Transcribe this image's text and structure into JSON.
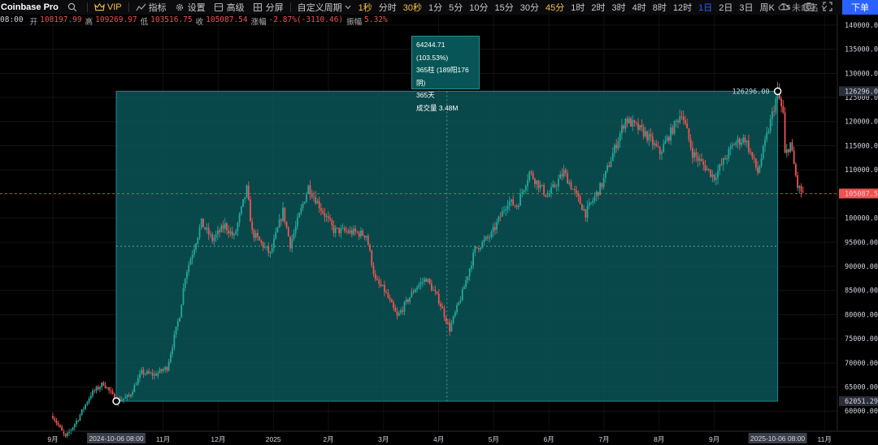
{
  "toolbar": {
    "symbol": "Coinbase Pro",
    "vip": "VIP",
    "indicators": "指标",
    "settings": "设置",
    "advanced": "高级",
    "split": "分屏",
    "custom_period": "自定义周期",
    "intervals": [
      {
        "label": "1秒",
        "state": "hl"
      },
      {
        "label": "分时",
        "state": ""
      },
      {
        "label": "30秒",
        "state": "hl"
      },
      {
        "label": "1分",
        "state": ""
      },
      {
        "label": "5分",
        "state": ""
      },
      {
        "label": "10分",
        "state": ""
      },
      {
        "label": "15分",
        "state": ""
      },
      {
        "label": "30分",
        "state": ""
      },
      {
        "label": "45分",
        "state": "hl"
      },
      {
        "label": "1时",
        "state": ""
      },
      {
        "label": "2时",
        "state": ""
      },
      {
        "label": "3时",
        "state": ""
      },
      {
        "label": "4时",
        "state": ""
      },
      {
        "label": "8时",
        "state": ""
      },
      {
        "label": "12时",
        "state": ""
      },
      {
        "label": "1日",
        "state": "active"
      },
      {
        "label": "2日",
        "state": ""
      },
      {
        "label": "3日",
        "state": ""
      },
      {
        "label": "周K",
        "state": ""
      },
      {
        "label": "1s",
        "state": ""
      }
    ],
    "unnamed": "未命名",
    "order": "下单"
  },
  "ohlc": {
    "time": "08:00",
    "open_label": "开",
    "open": "108197.99",
    "high_label": "高",
    "high": "109269.97",
    "low_label": "低",
    "low": "103516.75",
    "close_label": "收",
    "close": "105087.54",
    "change_label": "涨幅",
    "change": "-2.87%(-3110.46)",
    "amp_label": "振幅",
    "amp": "5.32%"
  },
  "tooltip": {
    "change": "64244.71 (103.53%)",
    "bars": "365柱 (189阳176阴)",
    "days": "365天",
    "volume": "成交量 3.48M"
  },
  "colors": {
    "up": "#26a69a",
    "down": "#ef5350",
    "range_fill": "#0b5557",
    "accent": "#2962ff"
  },
  "chart_data": {
    "type": "candlestick",
    "y_ticks": [
      "140000.00",
      "135000.00",
      "130000.00",
      "125000.00",
      "120000.00",
      "115000.00",
      "110000.00",
      "105000.00",
      "100000.00",
      "95000.00",
      "90000.00",
      "85000.00",
      "80000.00",
      "75000.00",
      "70000.00",
      "65000.00",
      "60000.00"
    ],
    "ylim": [
      56000,
      141500
    ],
    "x_ticks": [
      {
        "label": "9月",
        "m": 0
      },
      {
        "label": "11月",
        "m": 2
      },
      {
        "label": "12月",
        "m": 3
      },
      {
        "label": "2025",
        "m": 4
      },
      {
        "label": "2月",
        "m": 5
      },
      {
        "label": "3月",
        "m": 6
      },
      {
        "label": "4月",
        "m": 7
      },
      {
        "label": "5月",
        "m": 8
      },
      {
        "label": "6月",
        "m": 9
      },
      {
        "label": "7月",
        "m": 10
      },
      {
        "label": "8月",
        "m": 11
      },
      {
        "label": "9月",
        "m": 12
      },
      {
        "label": "11月",
        "m": 14
      }
    ],
    "range_start_label": "2024-10-06 08:00",
    "range_end_label": "2025-10-06 08:00",
    "range_start_price": 62051.29,
    "range_end_price": 126296.0,
    "range_high_label": "126296.00",
    "range_low_label": "62051.29",
    "last_price_label": "105087.54",
    "last_price": 105087.54,
    "range_mid_price": 94173.6,
    "anchors": [
      [
        "2024-09-01",
        59000
      ],
      [
        "2024-09-08",
        54500
      ],
      [
        "2024-09-15",
        58500
      ],
      [
        "2024-09-22",
        63500
      ],
      [
        "2024-09-29",
        65800
      ],
      [
        "2024-10-06",
        62100
      ],
      [
        "2024-10-13",
        63000
      ],
      [
        "2024-10-20",
        68000
      ],
      [
        "2024-10-27",
        67500
      ],
      [
        "2024-11-03",
        69000
      ],
      [
        "2024-11-10",
        80000
      ],
      [
        "2024-11-13",
        88000
      ],
      [
        "2024-11-22",
        99000
      ],
      [
        "2024-11-28",
        95500
      ],
      [
        "2024-12-05",
        98500
      ],
      [
        "2024-12-10",
        96000
      ],
      [
        "2024-12-17",
        106000
      ],
      [
        "2024-12-20",
        97000
      ],
      [
        "2024-12-30",
        92500
      ],
      [
        "2025-01-06",
        101500
      ],
      [
        "2025-01-10",
        94500
      ],
      [
        "2025-01-20",
        106500
      ],
      [
        "2025-01-27",
        102000
      ],
      [
        "2025-02-03",
        97500
      ],
      [
        "2025-02-15",
        97000
      ],
      [
        "2025-02-21",
        96500
      ],
      [
        "2025-02-26",
        87000
      ],
      [
        "2025-03-03",
        85000
      ],
      [
        "2025-03-10",
        79500
      ],
      [
        "2025-03-20",
        85500
      ],
      [
        "2025-03-26",
        87500
      ],
      [
        "2025-04-02",
        83000
      ],
      [
        "2025-04-08",
        77000
      ],
      [
        "2025-04-15",
        84500
      ],
      [
        "2025-04-22",
        93500
      ],
      [
        "2025-05-01",
        96500
      ],
      [
        "2025-05-10",
        103500
      ],
      [
        "2025-05-15",
        102500
      ],
      [
        "2025-05-22",
        109500
      ],
      [
        "2025-06-01",
        104500
      ],
      [
        "2025-06-10",
        109500
      ],
      [
        "2025-06-22",
        101000
      ],
      [
        "2025-07-01",
        107000
      ],
      [
        "2025-07-11",
        117500
      ],
      [
        "2025-07-14",
        120500
      ],
      [
        "2025-07-25",
        117500
      ],
      [
        "2025-08-02",
        113500
      ],
      [
        "2025-08-14",
        122000
      ],
      [
        "2025-08-20",
        113500
      ],
      [
        "2025-09-01",
        108500
      ],
      [
        "2025-09-12",
        115500
      ],
      [
        "2025-09-18",
        116500
      ],
      [
        "2025-09-25",
        109500
      ],
      [
        "2025-10-01",
        118500
      ],
      [
        "2025-10-06",
        126000
      ],
      [
        "2025-10-09",
        121500
      ],
      [
        "2025-10-10",
        113000
      ],
      [
        "2025-10-13",
        115500
      ],
      [
        "2025-10-17",
        106500
      ],
      [
        "2025-10-20",
        105087
      ]
    ]
  }
}
